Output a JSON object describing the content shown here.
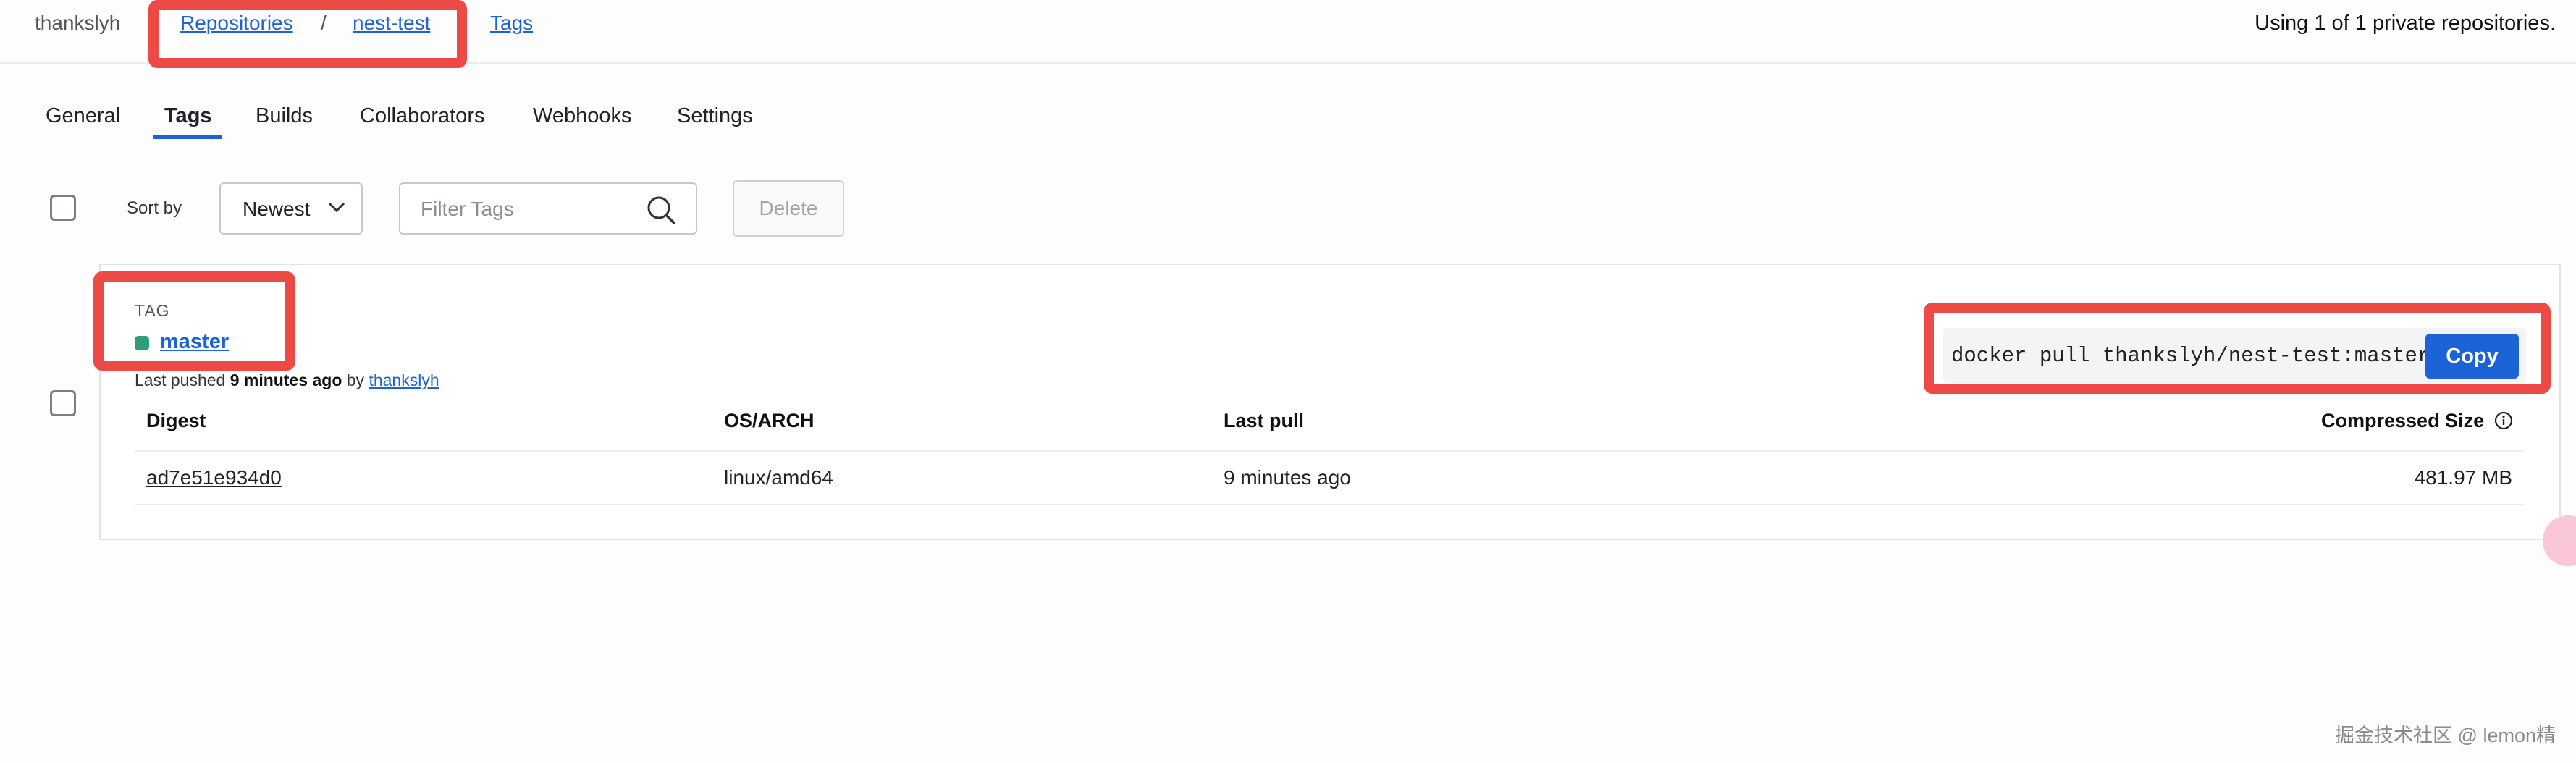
{
  "header": {
    "user": "thankslyh",
    "breadcrumb": [
      {
        "label": "Repositories"
      },
      {
        "label": "nest-test"
      },
      {
        "label": "Tags"
      }
    ],
    "separator": "/",
    "usage": "Using 1 of 1 private repositories."
  },
  "tabs": [
    {
      "label": "General",
      "active": false
    },
    {
      "label": "Tags",
      "active": true
    },
    {
      "label": "Builds",
      "active": false
    },
    {
      "label": "Collaborators",
      "active": false
    },
    {
      "label": "Webhooks",
      "active": false
    },
    {
      "label": "Settings",
      "active": false
    }
  ],
  "toolbar": {
    "sort_label": "Sort by",
    "sort_value": "Newest",
    "filter_placeholder": "Filter Tags",
    "delete_label": "Delete"
  },
  "tag": {
    "section_label": "TAG",
    "name": "master",
    "status_color": "#2e9e78",
    "pushed_prefix": "Last pushed",
    "pushed_time": "9 minutes ago",
    "pushed_by_word": "by",
    "pushed_by": "thankslyh",
    "pull_command": "docker pull thankslyh/nest-test:master",
    "copy_label": "Copy"
  },
  "table": {
    "columns": [
      "Digest",
      "OS/ARCH",
      "Last pull",
      "Compressed Size"
    ],
    "rows": [
      {
        "digest": "ad7e51e934d0",
        "os_arch": "linux/amd64",
        "last_pull": "9 minutes ago",
        "size": "481.97 MB"
      }
    ]
  },
  "watermark": "掘金技术社区 @ lemon精",
  "colors": {
    "accent": "#1d63d8",
    "annotation": "#ee4a45",
    "status_green": "#2e9e78"
  }
}
